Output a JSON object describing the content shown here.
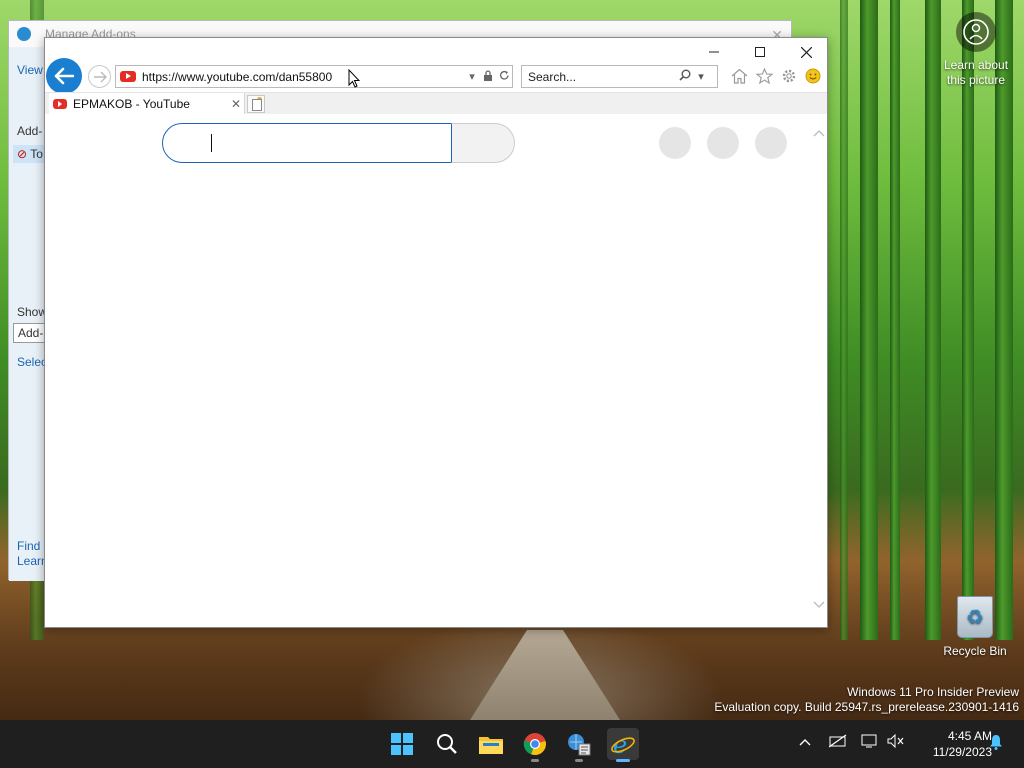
{
  "background_window": {
    "title": "Manage Add-ons",
    "side_texts": [
      "View",
      "Add-",
      "To",
      "Show",
      "Add-",
      "Selec",
      "Find",
      "Learn"
    ]
  },
  "browser": {
    "address_url": "https://www.youtube.com/dan55800",
    "search_placeholder": "Search...",
    "tab_title": "EPMAKOB - YouTube",
    "accent_color": "#1a7fd0"
  },
  "desktop": {
    "learn_label_line1": "Learn about",
    "learn_label_line2": "this picture",
    "recycle_bin_label": "Recycle Bin",
    "watermark_line1": "Windows 11 Pro Insider Preview",
    "watermark_line2": "Evaluation copy. Build 25947.rs_prerelease.230901-1416"
  },
  "taskbar": {
    "time": "4:45 AM",
    "date": "11/29/2023",
    "apps": [
      "start-icon",
      "search-icon",
      "file-explorer-icon",
      "chrome-icon",
      "control-panel-icon",
      "internet-explorer-icon"
    ]
  }
}
